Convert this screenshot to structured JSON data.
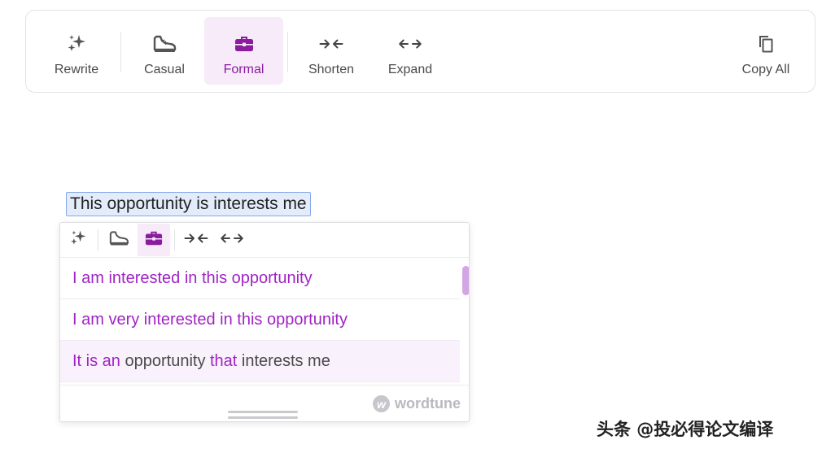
{
  "toolbar": {
    "rewrite_label": "Rewrite",
    "casual_label": "Casual",
    "formal_label": "Formal",
    "shorten_label": "Shorten",
    "expand_label": "Expand",
    "copy_all_label": "Copy All",
    "active": "Formal"
  },
  "editor": {
    "selected_text": "This opportunity is interests me"
  },
  "popup": {
    "tools": [
      "sparkles-icon",
      "sneaker-icon",
      "briefcase-icon",
      "shorten-arrows-icon",
      "expand-arrows-icon"
    ],
    "suggestions": [
      {
        "parts": [
          {
            "text": "I am interested in this opportunity",
            "changed": true
          }
        ]
      },
      {
        "parts": [
          {
            "text": "I am very interested in this opportunity",
            "changed": true
          }
        ]
      },
      {
        "parts": [
          {
            "text": "It is an ",
            "changed": true
          },
          {
            "text": "opportunity ",
            "changed": false
          },
          {
            "text": "that",
            "changed": true
          },
          {
            "text": " interests me",
            "changed": false
          }
        ]
      }
    ],
    "brand": "wordtune",
    "brand_logo_letter": "w"
  },
  "watermark": "头条 @投必得论文编译",
  "colors": {
    "accent": "#8a1d9e",
    "suggestion_text": "#a024c4",
    "active_bg": "#f7eaf9",
    "selection_bg": "#e3ecfb",
    "selection_border": "#86a9e8"
  }
}
